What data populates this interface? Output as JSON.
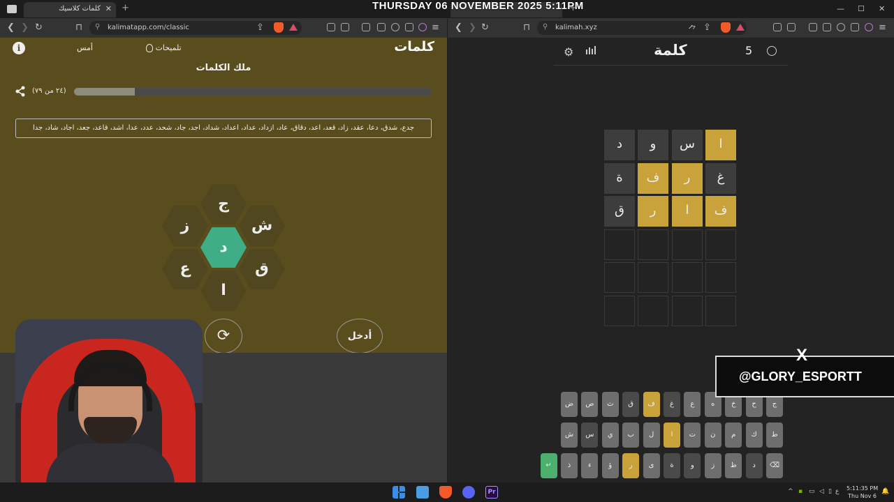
{
  "overlay": {
    "date_text": "THURSDAY 06 NOVEMBER 2025 5:11PM"
  },
  "left_browser": {
    "tab_title": "كلمات كلاسيك",
    "url": "kalimatapp.com/classic"
  },
  "right_browser": {
    "url": "kalimah.xyz"
  },
  "kalimat_app": {
    "logo": "كلمات",
    "hints_label": "تلميحات",
    "yesterday_label": "أمس",
    "info_icon": "i",
    "rank_title": "ملك الكلمات",
    "progress_text": "(٢٤ من ٧٩)",
    "progress_fraction": 0.17,
    "found_words": "جدع، شدق، دعا، عقد، زاد، قعد، اعد، دقاق، عاد، ازداد، عداد، اعداد، شداد، اجد، جاد، شحد، عدد، عدا، اشد، قاعد، جعد، اجاد، شاد، جدا",
    "letters": {
      "center": "د",
      "top": "ج",
      "top_right": "ش",
      "bottom_right": "ق",
      "bottom": "ا",
      "bottom_left": "ع",
      "top_left": "ز"
    },
    "shuffle_icon": "⟳",
    "enter_label": "أدخل"
  },
  "kalimah_app": {
    "logo": "كلمة",
    "streak": "5",
    "board": [
      {
        "letters": [
          "ا",
          "س",
          "و",
          "د"
        ],
        "states": [
          "gold",
          "gray",
          "gray",
          "gray"
        ]
      },
      {
        "letters": [
          "غ",
          "ر",
          "ف",
          "ة"
        ],
        "states": [
          "gray",
          "gold",
          "gold",
          "gray"
        ]
      },
      {
        "letters": [
          "ف",
          "ا",
          "ر",
          "ق"
        ],
        "states": [
          "gold",
          "gold",
          "gold",
          "gray"
        ]
      },
      {
        "letters": [
          "",
          "",
          "",
          ""
        ],
        "states": [
          "empty",
          "empty",
          "empty",
          "empty"
        ]
      },
      {
        "letters": [
          "",
          "",
          "",
          ""
        ],
        "states": [
          "empty",
          "empty",
          "empty",
          "empty"
        ]
      },
      {
        "letters": [
          "",
          "",
          "",
          ""
        ],
        "states": [
          "empty",
          "empty",
          "empty",
          "empty"
        ]
      }
    ],
    "keyboard": [
      [
        {
          "k": "ج",
          "s": ""
        },
        {
          "k": "ح",
          "s": ""
        },
        {
          "k": "خ",
          "s": ""
        },
        {
          "k": "ه",
          "s": ""
        },
        {
          "k": "ع",
          "s": ""
        },
        {
          "k": "غ",
          "s": "dark"
        },
        {
          "k": "ف",
          "s": "gold"
        },
        {
          "k": "ق",
          "s": "dark"
        },
        {
          "k": "ث",
          "s": ""
        },
        {
          "k": "ص",
          "s": ""
        },
        {
          "k": "ض",
          "s": ""
        }
      ],
      [
        {
          "k": "ط",
          "s": ""
        },
        {
          "k": "ك",
          "s": ""
        },
        {
          "k": "م",
          "s": ""
        },
        {
          "k": "ن",
          "s": ""
        },
        {
          "k": "ت",
          "s": ""
        },
        {
          "k": "ا",
          "s": "gold"
        },
        {
          "k": "ل",
          "s": ""
        },
        {
          "k": "ب",
          "s": ""
        },
        {
          "k": "ي",
          "s": ""
        },
        {
          "k": "س",
          "s": "dark"
        },
        {
          "k": "ش",
          "s": ""
        }
      ],
      [
        {
          "k": "⌫",
          "s": ""
        },
        {
          "k": "د",
          "s": "dark"
        },
        {
          "k": "ظ",
          "s": ""
        },
        {
          "k": "ز",
          "s": ""
        },
        {
          "k": "و",
          "s": "dark"
        },
        {
          "k": "ة",
          "s": "dark"
        },
        {
          "k": "ى",
          "s": ""
        },
        {
          "k": "ر",
          "s": "gold"
        },
        {
          "k": "ؤ",
          "s": ""
        },
        {
          "k": "ء",
          "s": ""
        },
        {
          "k": "ذ",
          "s": ""
        },
        {
          "k": "↵",
          "s": "green"
        }
      ]
    ]
  },
  "social": {
    "handle": "@GLORY_ESPORTT",
    "platform_icon": "X"
  },
  "taskbar": {
    "time": "5:11:35 PM",
    "date": "Thu Nov 6",
    "lang": "ع"
  }
}
